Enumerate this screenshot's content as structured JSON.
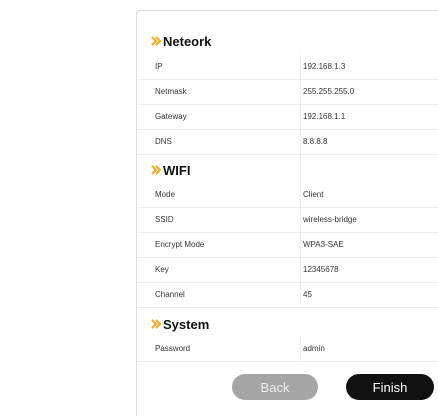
{
  "sections": {
    "network": {
      "title": "Neteork",
      "rows": [
        {
          "key": "IP",
          "value": "192.168.1.3"
        },
        {
          "key": "Netmask",
          "value": "255.255.255.0"
        },
        {
          "key": "Gateway",
          "value": "192.168.1.1"
        },
        {
          "key": "DNS",
          "value": "8.8.8.8"
        }
      ]
    },
    "wifi": {
      "title": "WIFI",
      "rows": [
        {
          "key": "Mode",
          "value": "Client"
        },
        {
          "key": "SSID",
          "value": "wireless-bridge"
        },
        {
          "key": "Encrypt Mode",
          "value": "WPA3-SAE"
        },
        {
          "key": "Key",
          "value": "12345678"
        },
        {
          "key": "Channel",
          "value": "45"
        }
      ]
    },
    "system": {
      "title": "System",
      "rows": [
        {
          "key": "Password",
          "value": "admin"
        }
      ]
    }
  },
  "buttons": {
    "back": "Back",
    "finish": "Finish"
  },
  "colors": {
    "section_arrow": "#f5a623",
    "back_button": "#a6a6a6",
    "finish_button": "#111111"
  },
  "icons": {
    "section_marker": "double-chevron-right-icon"
  }
}
